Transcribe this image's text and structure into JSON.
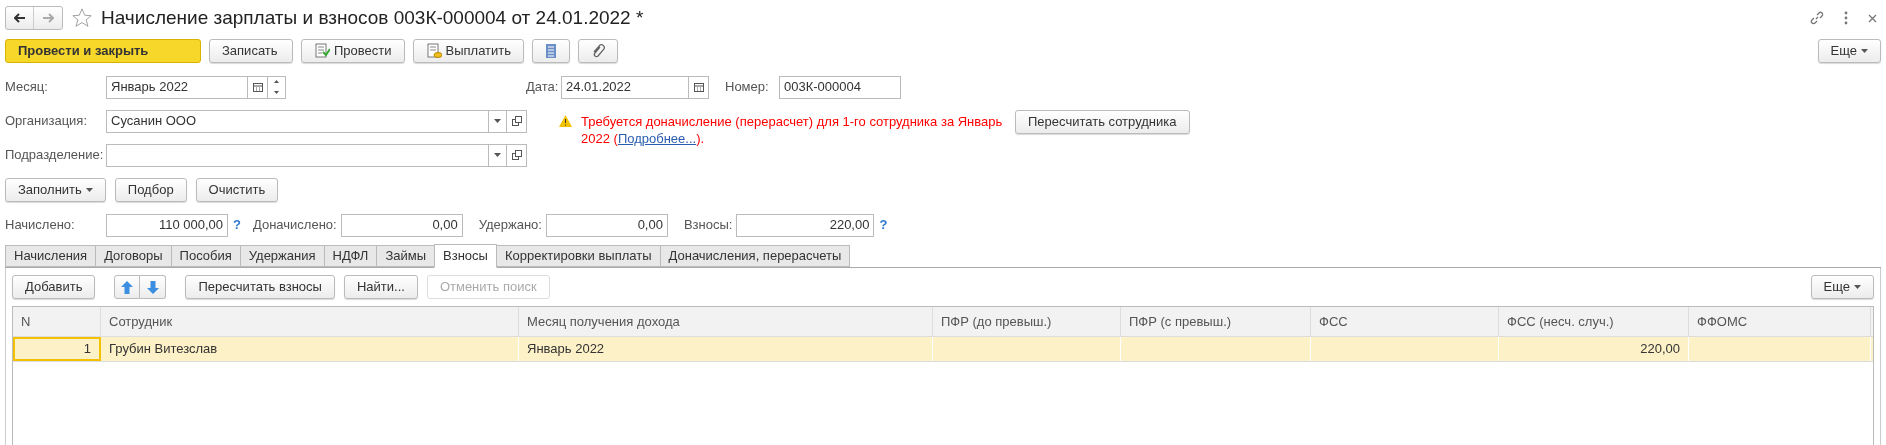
{
  "window": {
    "title": "Начисление зарплаты и взносов 003К-000004 от 24.01.2022 *",
    "favorite": false
  },
  "toolbar": [
    {
      "kind": "primary",
      "label": "Провести и закрыть"
    },
    {
      "kind": "plain",
      "label": "Записать"
    },
    {
      "kind": "post",
      "label": "Провести"
    },
    {
      "kind": "pay",
      "label": "Выплатить"
    },
    {
      "kind": "list"
    },
    {
      "kind": "clip"
    }
  ],
  "more_button": {
    "label": "Еще"
  },
  "month": {
    "label": "Месяц:",
    "value": "Январь 2022"
  },
  "date": {
    "label": "Дата:",
    "value": "24.01.2022"
  },
  "number": {
    "label": "Номер:",
    "value": "003К-000004"
  },
  "organization": {
    "label": "Организация:",
    "value": "Сусанин ООО"
  },
  "subdivision": {
    "label": "Подразделение:"
  },
  "warning": {
    "text": "Требуется доначисление (перерасчет) для 1-го сотрудника за Январь 2022 (",
    "link": "Подробнее...",
    "tail": ")."
  },
  "recalc_button": {
    "label": "Пересчитать сотрудника"
  },
  "fill_buttons": [
    {
      "label": "Заполнить",
      "dropdown": true
    },
    {
      "label": "Подбор",
      "dropdown": false
    },
    {
      "label": "Очистить",
      "dropdown": false
    }
  ],
  "totals": [
    {
      "label": "Начислено:",
      "value": "110 000,00",
      "help": "?"
    },
    {
      "label": "Доначислено:",
      "value": "0,00"
    },
    {
      "label": "Удержано:",
      "value": "0,00"
    },
    {
      "label": "Взносы:",
      "value": "220,00",
      "help": "?"
    }
  ],
  "tabs": [
    {
      "label": "Начисления",
      "selected": false
    },
    {
      "label": "Договоры",
      "selected": false
    },
    {
      "label": "Пособия",
      "selected": false
    },
    {
      "label": "Удержания",
      "selected": false
    },
    {
      "label": "НДФЛ",
      "selected": false
    },
    {
      "label": "Займы",
      "selected": false
    },
    {
      "label": "Взносы",
      "selected": true
    },
    {
      "label": "Корректировки выплаты",
      "selected": false
    },
    {
      "label": "Доначисления, перерасчеты",
      "selected": false
    }
  ],
  "table_toolbar": [
    {
      "kind": "button",
      "label": "Добавить",
      "disabled": false
    },
    {
      "kind": "arrows"
    },
    {
      "kind": "button",
      "label": "Пересчитать взносы",
      "disabled": false
    },
    {
      "kind": "button",
      "label": "Найти...",
      "disabled": false
    },
    {
      "kind": "button",
      "label": "Отменить поиск",
      "disabled": true
    }
  ],
  "table_more": {
    "label": "Еще"
  },
  "table": {
    "columns": [
      {
        "label": "N"
      },
      {
        "label": "Сотрудник"
      },
      {
        "label": "Месяц получения дохода"
      },
      {
        "label": "ПФР (до превыш.)"
      },
      {
        "label": "ПФР (с превыш.)"
      },
      {
        "label": "ФСС"
      },
      {
        "label": "ФСС (несч. случ.)"
      },
      {
        "label": "ФФОМС"
      }
    ],
    "rows": [
      {
        "selected": true,
        "cells": [
          "1",
          "Грубин Витезслав",
          "Январь 2022",
          "",
          "",
          "",
          "220,00",
          ""
        ]
      }
    ]
  }
}
